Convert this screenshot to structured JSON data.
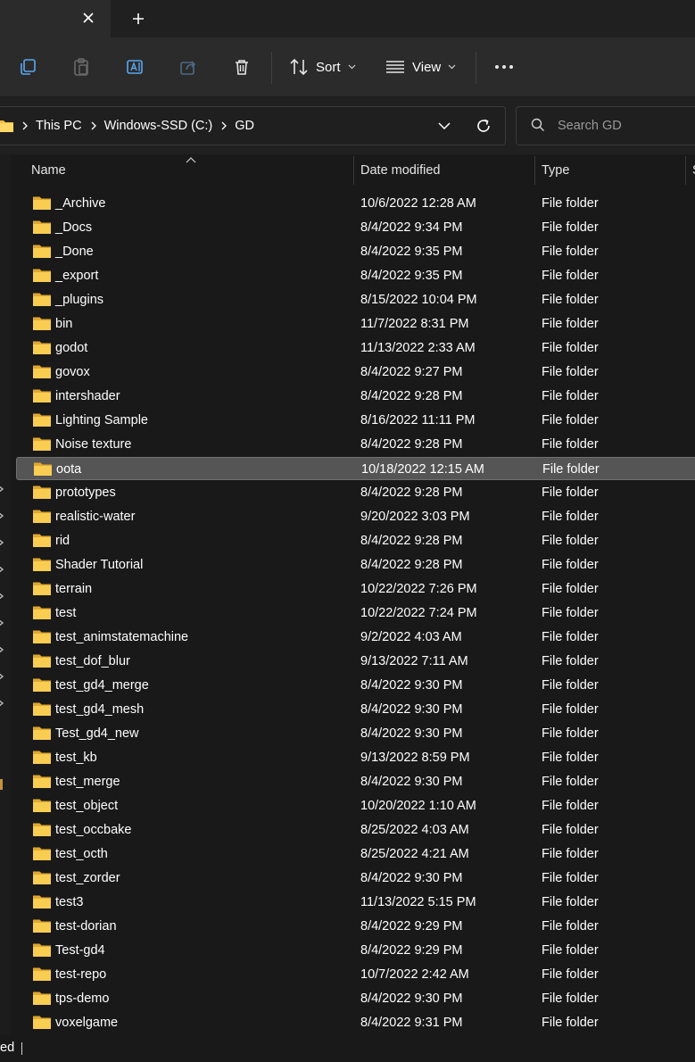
{
  "tabbar": {
    "close_glyph": "✕",
    "new_tab_glyph": "+"
  },
  "toolbar": {
    "sort_label": "Sort",
    "view_label": "View",
    "more_glyph": "•••"
  },
  "address": {
    "crumbs": [
      "This PC",
      "Windows-SSD (C:)",
      "GD"
    ]
  },
  "search": {
    "placeholder": "Search GD"
  },
  "columns": {
    "name": "Name",
    "date": "Date modified",
    "type": "Type",
    "size_partial": "S"
  },
  "colors": {
    "accent_folder": "#f4c042",
    "selected_row": "#555555"
  },
  "files": [
    {
      "name": "_Archive",
      "date": "10/6/2022 12:28 AM",
      "type": "File folder"
    },
    {
      "name": "_Docs",
      "date": "8/4/2022 9:34 PM",
      "type": "File folder"
    },
    {
      "name": "_Done",
      "date": "8/4/2022 9:35 PM",
      "type": "File folder"
    },
    {
      "name": "_export",
      "date": "8/4/2022 9:35 PM",
      "type": "File folder"
    },
    {
      "name": "_plugins",
      "date": "8/15/2022 10:04 PM",
      "type": "File folder"
    },
    {
      "name": "bin",
      "date": "11/7/2022 8:31 PM",
      "type": "File folder"
    },
    {
      "name": "godot",
      "date": "11/13/2022 2:33 AM",
      "type": "File folder"
    },
    {
      "name": "govox",
      "date": "8/4/2022 9:27 PM",
      "type": "File folder"
    },
    {
      "name": "intershader",
      "date": "8/4/2022 9:28 PM",
      "type": "File folder"
    },
    {
      "name": "Lighting Sample",
      "date": "8/16/2022 11:11 PM",
      "type": "File folder"
    },
    {
      "name": "Noise texture",
      "date": "8/4/2022 9:28 PM",
      "type": "File folder"
    },
    {
      "name": "oota",
      "date": "10/18/2022 12:15 AM",
      "type": "File folder",
      "selected": true
    },
    {
      "name": "prototypes",
      "date": "8/4/2022 9:28 PM",
      "type": "File folder"
    },
    {
      "name": "realistic-water",
      "date": "9/20/2022 3:03 PM",
      "type": "File folder"
    },
    {
      "name": "rid",
      "date": "8/4/2022 9:28 PM",
      "type": "File folder"
    },
    {
      "name": "Shader Tutorial",
      "date": "8/4/2022 9:28 PM",
      "type": "File folder"
    },
    {
      "name": "terrain",
      "date": "10/22/2022 7:26 PM",
      "type": "File folder"
    },
    {
      "name": "test",
      "date": "10/22/2022 7:24 PM",
      "type": "File folder"
    },
    {
      "name": "test_animstatemachine",
      "date": "9/2/2022 4:03 AM",
      "type": "File folder"
    },
    {
      "name": "test_dof_blur",
      "date": "9/13/2022 7:11 AM",
      "type": "File folder"
    },
    {
      "name": "test_gd4_merge",
      "date": "8/4/2022 9:30 PM",
      "type": "File folder"
    },
    {
      "name": "test_gd4_mesh",
      "date": "8/4/2022 9:30 PM",
      "type": "File folder"
    },
    {
      "name": "Test_gd4_new",
      "date": "8/4/2022 9:30 PM",
      "type": "File folder"
    },
    {
      "name": "test_kb",
      "date": "9/13/2022 8:59 PM",
      "type": "File folder"
    },
    {
      "name": "test_merge",
      "date": "8/4/2022 9:30 PM",
      "type": "File folder"
    },
    {
      "name": "test_object",
      "date": "10/20/2022 1:10 AM",
      "type": "File folder"
    },
    {
      "name": "test_occbake",
      "date": "8/25/2022 4:03 AM",
      "type": "File folder"
    },
    {
      "name": "test_octh",
      "date": "8/25/2022 4:21 AM",
      "type": "File folder"
    },
    {
      "name": "test_zorder",
      "date": "8/4/2022 9:30 PM",
      "type": "File folder"
    },
    {
      "name": "test3",
      "date": "11/13/2022 5:15 PM",
      "type": "File folder"
    },
    {
      "name": "test-dorian",
      "date": "8/4/2022 9:29 PM",
      "type": "File folder"
    },
    {
      "name": "Test-gd4",
      "date": "8/4/2022 9:29 PM",
      "type": "File folder"
    },
    {
      "name": "test-repo",
      "date": "10/7/2022 2:42 AM",
      "type": "File folder"
    },
    {
      "name": "tps-demo",
      "date": "8/4/2022 9:30 PM",
      "type": "File folder"
    },
    {
      "name": "voxelgame",
      "date": "8/4/2022 9:31 PM",
      "type": "File folder"
    }
  ],
  "status": {
    "partial_text": "ed"
  }
}
